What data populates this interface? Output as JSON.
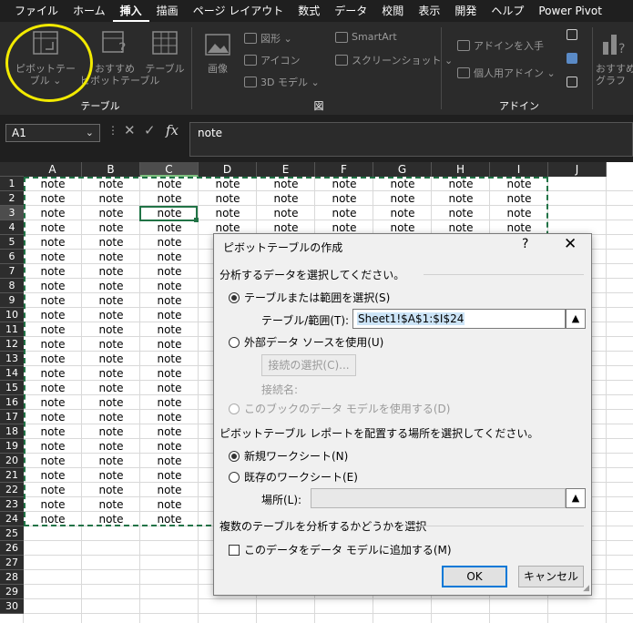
{
  "menu": {
    "items": [
      "ファイル",
      "ホーム",
      "挿入",
      "描画",
      "ページ レイアウト",
      "数式",
      "データ",
      "校閲",
      "表示",
      "開発",
      "ヘルプ",
      "Power Pivot"
    ],
    "active_index": 2
  },
  "ribbon": {
    "pivot_table": "ピボットテー\nブル ⌄",
    "recommended_pivot": "おすすめ\nピボットテーブル",
    "table": "テーブル",
    "group_table": "テーブル",
    "image": "画像",
    "shapes": "図形 ⌄",
    "icons": "アイコン",
    "model_3d": "3D モデル ⌄",
    "smartart": "SmartArt",
    "screenshot": "スクリーンショット ⌄",
    "group_illust": "図",
    "get_addins": "アドインを入手",
    "my_addins": "個人用アドイン ⌄",
    "group_addins": "アドイン",
    "recommended_chart": "おすすめ\nグラフ"
  },
  "formula_bar": {
    "name_box": "A1",
    "value": "note"
  },
  "sheet": {
    "columns": [
      "A",
      "B",
      "C",
      "D",
      "E",
      "F",
      "G",
      "H",
      "I",
      "J"
    ],
    "selected_column": "C",
    "rows": 30,
    "selected_row": 3,
    "filled_rows": 24,
    "filled_columns": 9,
    "cell_text": "note"
  },
  "dialog": {
    "title": "ピボットテーブルの作成",
    "help": "?",
    "close": "✕",
    "section1": "分析するデータを選択してください。",
    "radio_range": "テーブルまたは範囲を選択(S)",
    "range_label": "テーブル/範囲(T):",
    "range_value": "Sheet1!$A$1:$I$24",
    "radio_external": "外部データ ソースを使用(U)",
    "connection_button": "接続の選択(C)...",
    "connection_name": "接続名:",
    "radio_model": "このブックのデータ モデルを使用する(D)",
    "section2": "ピボットテーブル レポートを配置する場所を選択してください。",
    "radio_new": "新規ワークシート(N)",
    "radio_existing": "既存のワークシート(E)",
    "location_label": "場所(L):",
    "location_value": "",
    "section3": "複数のテーブルを分析するかどうかを選択",
    "checkbox_model": "このデータをデータ モデルに追加する(M)",
    "ok": "OK",
    "cancel": "キャンセル",
    "collapse_icon": "▲"
  },
  "colors": {
    "accent": "#217346",
    "highlight": "#f2ea00",
    "default_button": "#0078d7"
  }
}
